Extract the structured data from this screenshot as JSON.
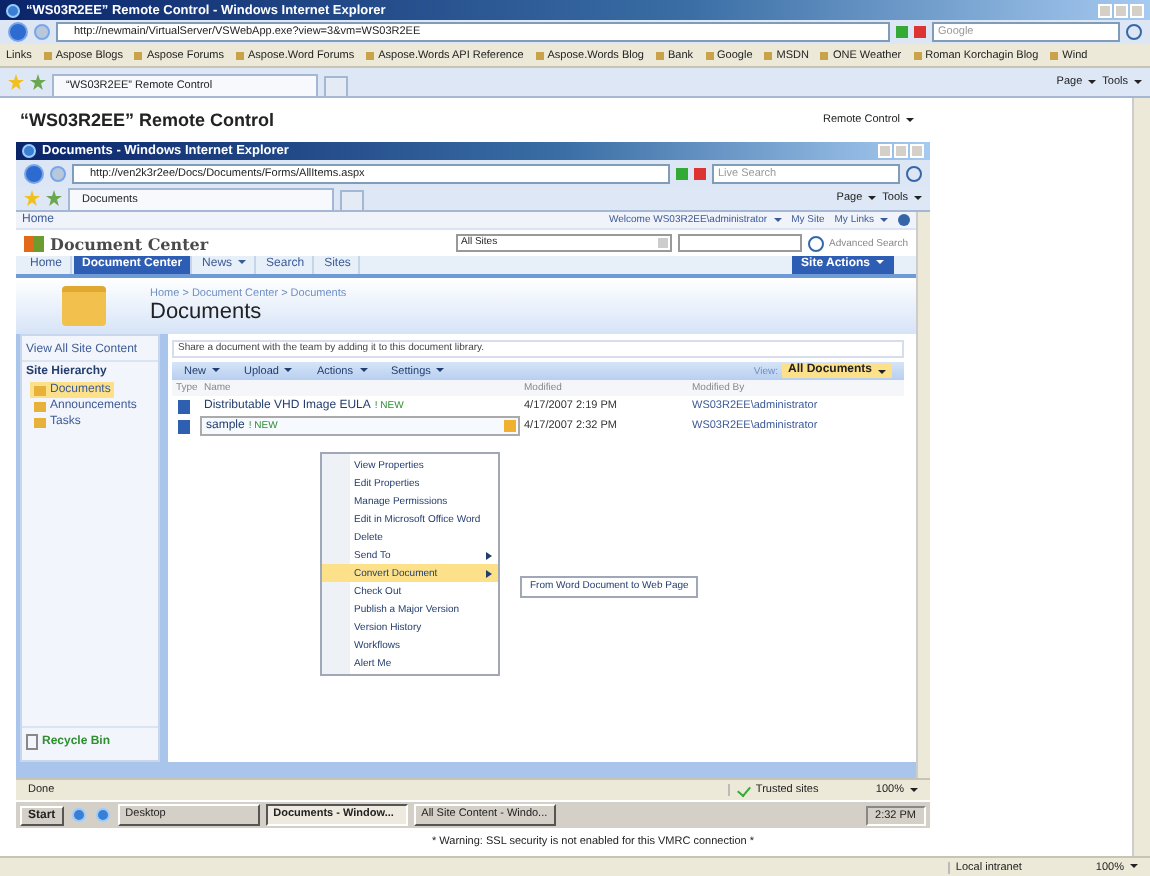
{
  "outer_window": {
    "title": "“WS03R2EE” Remote Control - Windows Internet Explorer"
  },
  "outer_address_bar": {
    "url": "http://newmain/VirtualServer/VSWebApp.exe?view=3&vm=WS03R2EE",
    "search_placeholder": "Google"
  },
  "links_bar": {
    "label": "Links",
    "links": [
      "Aspose Blogs",
      "Aspose Forums",
      "Aspose.Word Forums",
      "Aspose.Words API Reference",
      "Aspose.Words Blog",
      "Bank",
      "Google",
      "MSDN",
      "ONE Weather",
      "Roman Korchagin Blog",
      "Wind"
    ]
  },
  "outer_tab_bar": {
    "tabs": [
      {
        "label": "“WS03R2EE” Remote Control",
        "selected": true
      }
    ],
    "tools": [
      "Page",
      "Tools"
    ]
  },
  "remote_page": {
    "title": "“WS03R2EE” Remote Control",
    "menu": "Remote Control",
    "warning": "* Warning: SSL security is not enabled for this VMRC connection *"
  },
  "inner_window": {
    "title": "Documents - Windows Internet Explorer",
    "url": "http://ven2k3r2ee/Docs/Documents/Forms/AllItems.aspx",
    "search_placeholder": "Live Search",
    "tabs": [
      {
        "label": "Documents",
        "selected": true
      }
    ],
    "tools": [
      "Page",
      "Tools"
    ]
  },
  "site": {
    "top_link": "Home",
    "welcome": "Welcome WS03R2EE\\administrator",
    "my_site": "My Site",
    "my_links": "My Links",
    "logo_title": "Document Center",
    "scope": "All Sites",
    "advanced_search": "Advanced Search",
    "nav": [
      {
        "label": "Home",
        "selected": false,
        "dropdown": false
      },
      {
        "label": "Document Center",
        "selected": true,
        "dropdown": false
      },
      {
        "label": "News",
        "selected": false,
        "dropdown": true
      },
      {
        "label": "Search",
        "selected": false,
        "dropdown": false
      },
      {
        "label": "Sites",
        "selected": false,
        "dropdown": false
      }
    ],
    "site_actions": "Site Actions",
    "breadcrumb": "Home > Document Center > Documents",
    "page_title": "Documents",
    "description": "Share a document with the team by adding it to this document library.",
    "quick_launch": {
      "view_all": "View All Site Content",
      "heading": "Site Hierarchy",
      "recycle_bin": "Recycle Bin",
      "items": [
        {
          "label": "Documents",
          "selected": true
        },
        {
          "label": "Announcements",
          "selected": false
        },
        {
          "label": "Tasks",
          "selected": false
        }
      ]
    },
    "toolbar": {
      "menus": [
        "New",
        "Upload",
        "Actions",
        "Settings"
      ],
      "view_label": "View:",
      "view": "All Documents"
    },
    "columns": [
      "Type",
      "Name",
      "Modified",
      "Modified By"
    ],
    "rows": [
      {
        "name": "Distributable VHD Image EULA",
        "badge": "! NEW",
        "modified": "4/17/2007 2:19 PM",
        "modified_by": "WS03R2EE\\administrator",
        "selected": false
      },
      {
        "name": "sample",
        "badge": "! NEW",
        "modified": "4/17/2007 2:32 PM",
        "modified_by": "WS03R2EE\\administrator",
        "selected": true
      }
    ],
    "context_menu": [
      {
        "label": "View Properties",
        "submenu": false,
        "selected": false
      },
      {
        "label": "Edit Properties",
        "submenu": false,
        "selected": false
      },
      {
        "label": "Manage Permissions",
        "submenu": false,
        "selected": false
      },
      {
        "label": "Edit in Microsoft Office Word",
        "submenu": false,
        "selected": false
      },
      {
        "label": "Delete",
        "submenu": false,
        "selected": false
      },
      {
        "label": "Send To",
        "submenu": true,
        "selected": false
      },
      {
        "label": "Convert Document",
        "submenu": true,
        "selected": true
      },
      {
        "label": "Check Out",
        "submenu": false,
        "selected": false
      },
      {
        "label": "Publish a Major Version",
        "submenu": false,
        "selected": false
      },
      {
        "label": "Version History",
        "submenu": false,
        "selected": false
      },
      {
        "label": "Workflows",
        "submenu": false,
        "selected": false
      },
      {
        "label": "Alert Me",
        "submenu": false,
        "selected": false
      }
    ],
    "submenu": [
      "From Word Document to Web Page"
    ]
  },
  "inner_status": {
    "text": "Done",
    "zone": "Trusted sites",
    "zoom": "100%"
  },
  "vm_taskbar": {
    "start": "Start",
    "buttons": [
      {
        "label": "Desktop",
        "selected": false
      },
      {
        "label": "Documents - Window...",
        "selected": true
      },
      {
        "label": "All Site Content - Windo...",
        "selected": false
      }
    ],
    "clock": "2:32 PM"
  },
  "outer_status": {
    "zone": "Local intranet",
    "zoom": "100%"
  }
}
